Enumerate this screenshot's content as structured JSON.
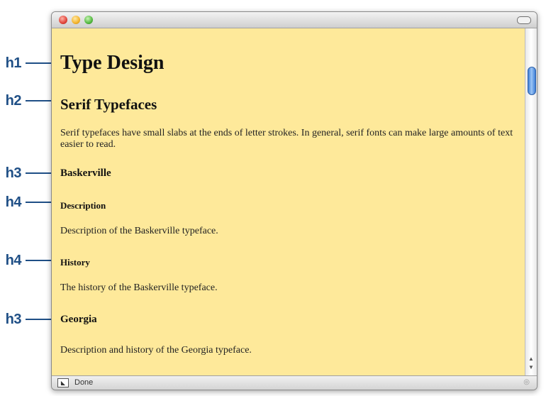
{
  "annotations": [
    {
      "label": "h1"
    },
    {
      "label": "h2"
    },
    {
      "label": "h3"
    },
    {
      "label": "h4"
    },
    {
      "label": "h4"
    },
    {
      "label": "h3"
    }
  ],
  "page": {
    "h1": "Type Design",
    "h2": "Serif Typefaces",
    "intro": "Serif typefaces have small slabs at the ends of letter strokes. In general, serif fonts can make large amounts of text easier to read.",
    "baskerville_heading": "Baskerville",
    "description_heading": "Description",
    "description_text": "Description of the Baskerville typeface.",
    "history_heading": "History",
    "history_text": "The history of the Baskerville typeface.",
    "georgia_heading": "Georgia",
    "georgia_text": "Description and history of the Georgia typeface."
  },
  "status": {
    "text": "Done"
  },
  "colors": {
    "page_background": "#fee99a",
    "annotation": "#1f4f86"
  }
}
